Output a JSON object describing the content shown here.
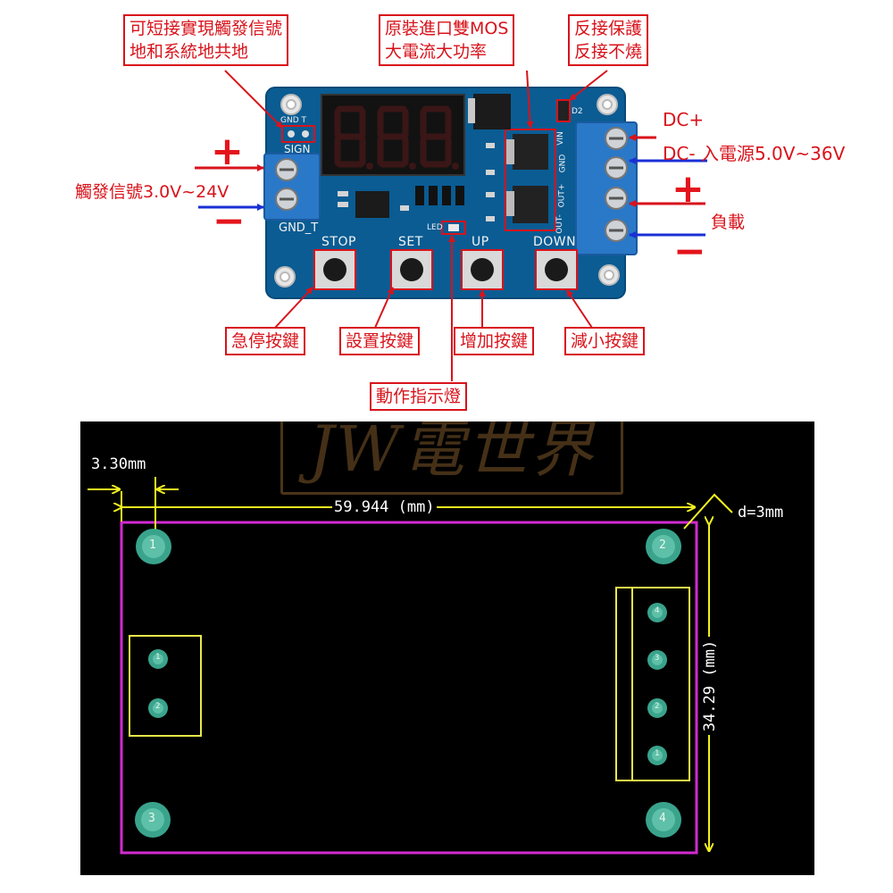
{
  "callouts": {
    "trigger_ground": [
      "可短接實現觸發信號",
      "地和系統地共地"
    ],
    "mos": [
      "原裝進口雙MOS",
      "大電流大功率"
    ],
    "reverse_protect": [
      "反接保護",
      "反接不燒"
    ],
    "dc_plus": "DC+",
    "dc_minus": "DC- 入電源5.0V~36V",
    "trigger_signal": "觸發信號3.0V~24V",
    "load": "負載",
    "stop_button": "急停按鍵",
    "set_button": "設置按鍵",
    "up_button": "增加按鍵",
    "down_button": "減小按鍵",
    "led_indicator": "動作指示燈"
  },
  "board": {
    "display_digits": "8.8.8.",
    "labels": {
      "sign": "SIGN",
      "gnd_t": "GND_T",
      "gnd_top": "GND T",
      "led": "LED",
      "stop": "STOP",
      "set": "SET",
      "up": "UP",
      "down": "DOWN",
      "vin": "VIN",
      "gnd": "GND",
      "out_plus": "OUT+",
      "out_minus": "OUT-",
      "d2": "D2"
    }
  },
  "polarity": {
    "plus": "+",
    "minus": "−"
  },
  "drawing": {
    "watermark": "JW電世界",
    "hole_offset": "3.30mm",
    "width_dim": "59.944 (mm)",
    "height_dim": "34.29 (mm)",
    "hole_diameter": "d=3mm",
    "hole_numbers": [
      "1",
      "2",
      "3",
      "4"
    ],
    "left_pins": [
      "1",
      "2"
    ],
    "right_pins": [
      "4",
      "3",
      "2",
      "1"
    ]
  },
  "colors": {
    "callout_red": "#d8131b",
    "pcb_blue": "#0a5c93",
    "terminal_blue": "#2a78c8",
    "outline_magenta": "#d22ad2",
    "silkscreen_yellow": "#e8e84a",
    "pad_teal": "#3aa38c"
  }
}
